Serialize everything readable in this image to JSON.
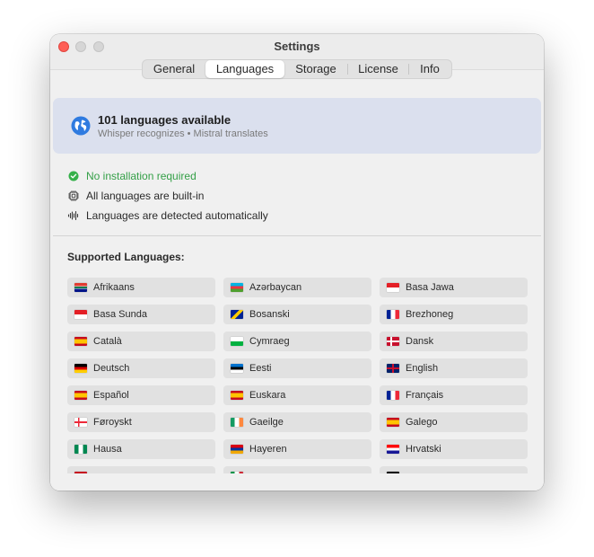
{
  "window": {
    "title": "Settings"
  },
  "tabs": [
    {
      "label": "General",
      "active": false
    },
    {
      "label": "Languages",
      "active": true
    },
    {
      "label": "Storage",
      "active": false
    },
    {
      "label": "License",
      "active": false
    },
    {
      "label": "Info",
      "active": false
    }
  ],
  "banner": {
    "icon": "globe-icon",
    "title": "101 languages available",
    "subtitle": "Whisper recognizes • Mistral translates"
  },
  "features": [
    {
      "icon": "checkmark-circle-icon",
      "text": "No installation required",
      "color": "#35a048"
    },
    {
      "icon": "cpu-chip-icon",
      "text": "All languages are built-in"
    },
    {
      "icon": "waveform-icon",
      "text": "Languages are detected automatically"
    }
  ],
  "section_title": "Supported Languages:",
  "languages": [
    {
      "name": "Afrikaans",
      "flag": "za"
    },
    {
      "name": "Azərbaycan",
      "flag": "az"
    },
    {
      "name": "Basa Jawa",
      "flag": "id"
    },
    {
      "name": "Basa Sunda",
      "flag": "id"
    },
    {
      "name": "Bosanski",
      "flag": "ba"
    },
    {
      "name": "Brezhoneg",
      "flag": "fr"
    },
    {
      "name": "Català",
      "flag": "es"
    },
    {
      "name": "Cymraeg",
      "flag": "wales"
    },
    {
      "name": "Dansk",
      "flag": "dk"
    },
    {
      "name": "Deutsch",
      "flag": "de"
    },
    {
      "name": "Eesti",
      "flag": "ee"
    },
    {
      "name": "English",
      "flag": "gb"
    },
    {
      "name": "Español",
      "flag": "es"
    },
    {
      "name": "Euskara",
      "flag": "es"
    },
    {
      "name": "Français",
      "flag": "fr"
    },
    {
      "name": "Føroyskt",
      "flag": "fo"
    },
    {
      "name": "Gaeilge",
      "flag": "ie"
    },
    {
      "name": "Galego",
      "flag": "es"
    },
    {
      "name": "Hausa",
      "flag": "ng"
    },
    {
      "name": "Hayeren",
      "flag": "am"
    },
    {
      "name": "Hrvatski",
      "flag": "hr"
    },
    {
      "name": "",
      "flag": "es"
    },
    {
      "name": "",
      "flag": "it"
    },
    {
      "name": "",
      "flag": "ke"
    }
  ]
}
